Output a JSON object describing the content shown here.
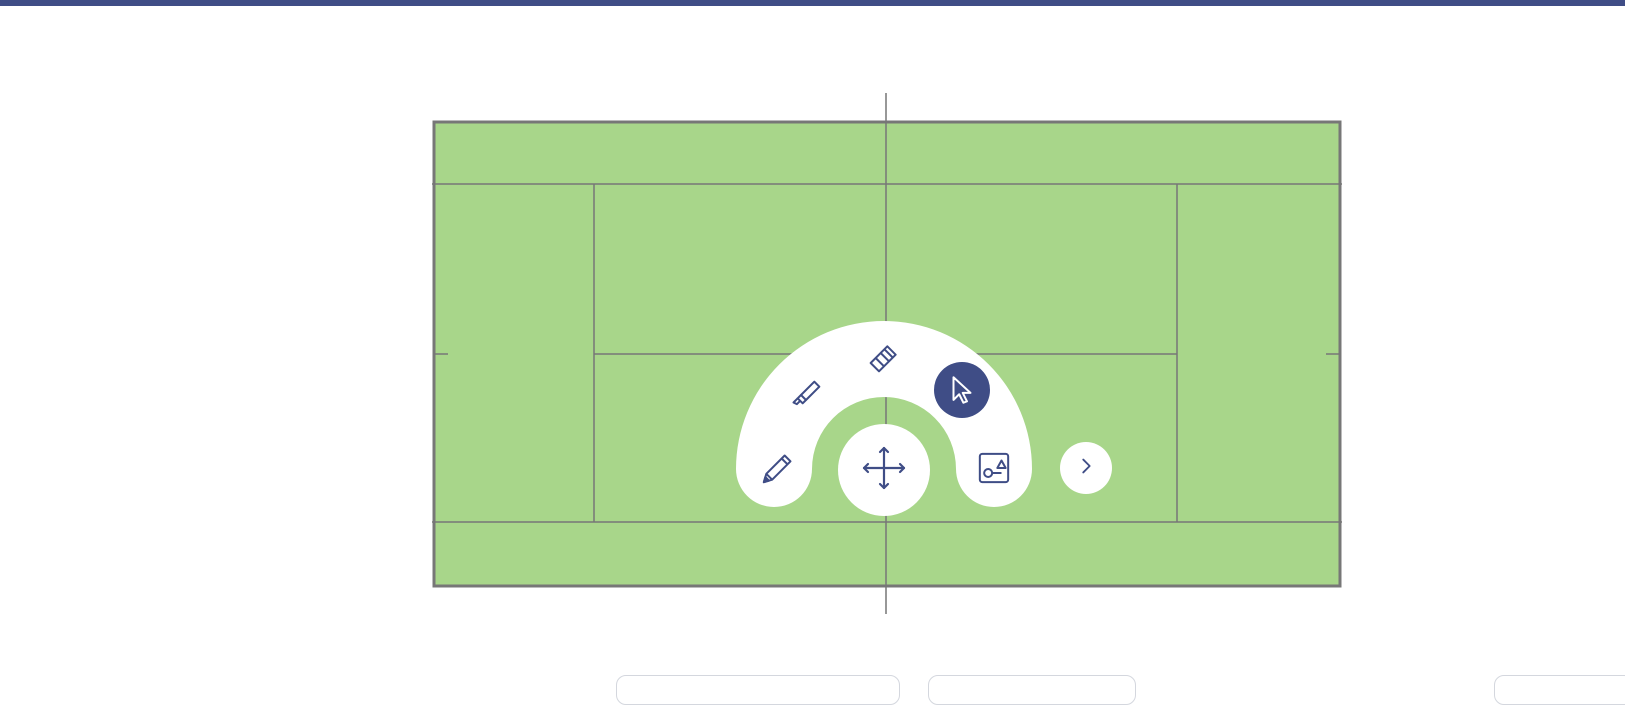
{
  "theme": {
    "header_color": "#3f4d86",
    "court_color": "#a8d68a",
    "court_line_color": "#777777",
    "toolbar_color": "#ffffff",
    "active_tool_color": "#3f4d86",
    "icon_color": "#3f4d86"
  },
  "court": {
    "type": "tennis-court"
  },
  "toolbar": {
    "tools": [
      {
        "id": "pencil",
        "icon": "pencil-icon",
        "active": false
      },
      {
        "id": "marker",
        "icon": "marker-icon",
        "active": false
      },
      {
        "id": "eraser",
        "icon": "eraser-icon",
        "active": false
      },
      {
        "id": "select",
        "icon": "cursor-icon",
        "active": true
      },
      {
        "id": "shapes",
        "icon": "shapes-icon",
        "active": false
      }
    ],
    "move_handle_icon": "move-arrows-icon",
    "expand_icon": "chevron-right-icon"
  },
  "bottom_tabs": [
    {
      "label": ""
    },
    {
      "label": ""
    },
    {
      "label": ""
    }
  ]
}
